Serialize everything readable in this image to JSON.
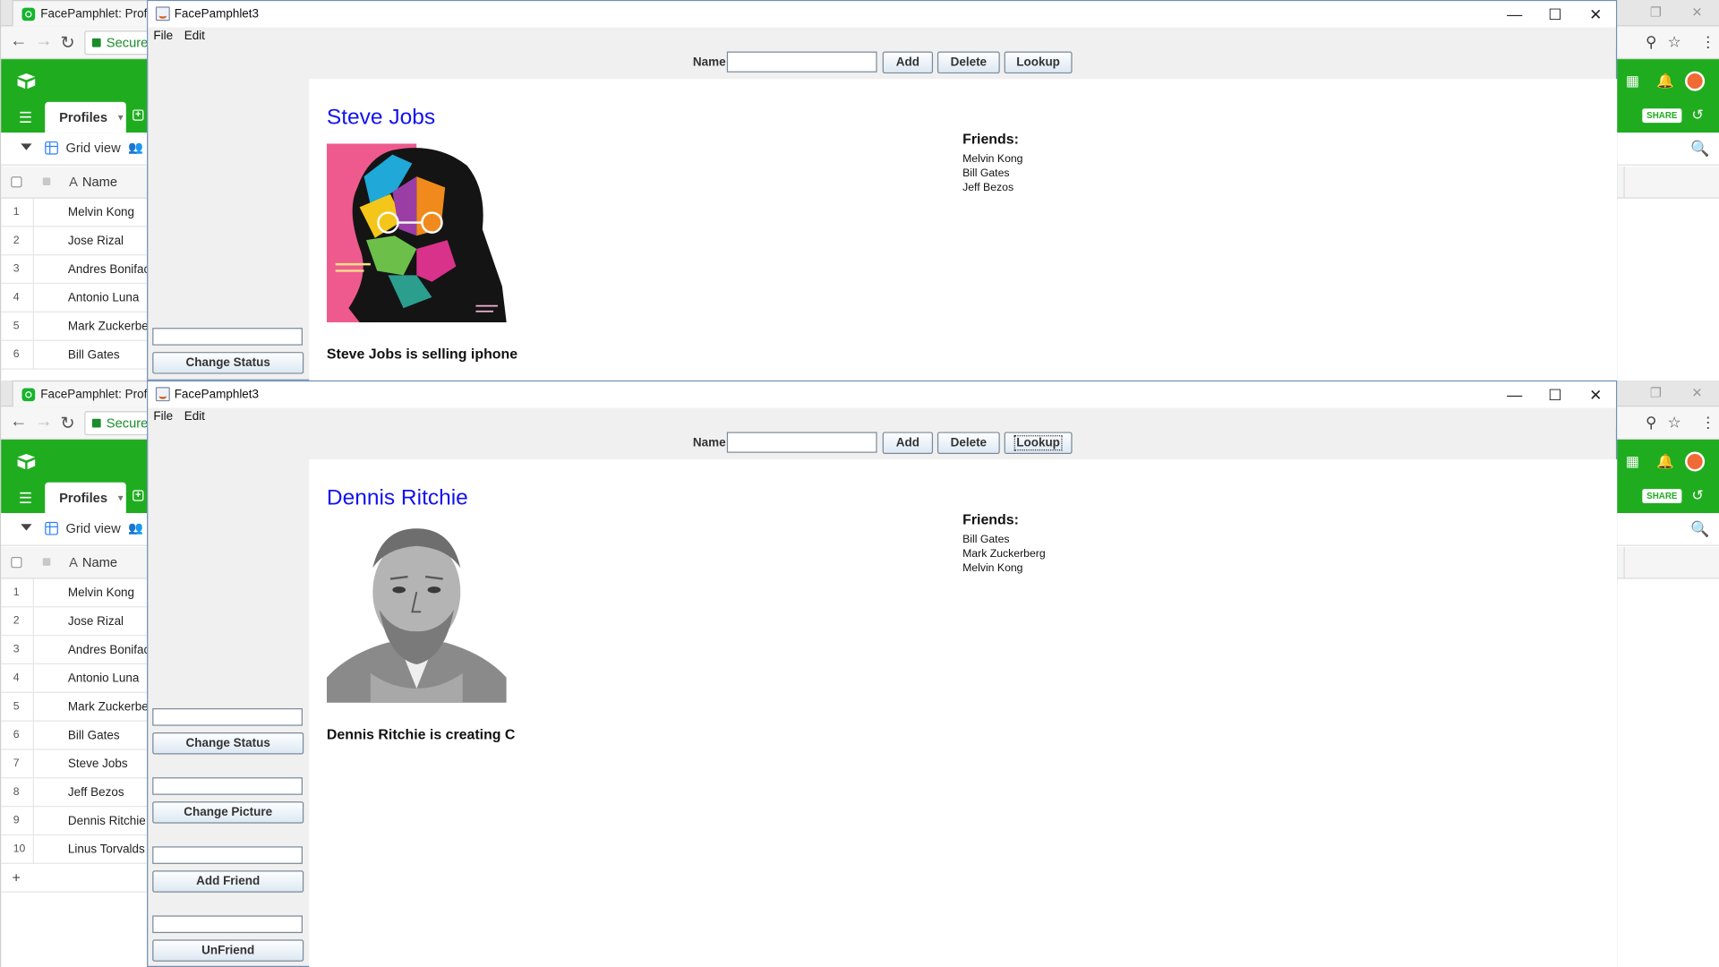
{
  "browser": {
    "tab_title": "FacePamphlet: Profiles",
    "omnibox": "Secure",
    "airtable": {
      "table_tab": "Profiles",
      "view_name": "Grid view",
      "share_label": "SHARE",
      "column_name": "Name",
      "column_type_glyph": "A",
      "rows_top": [
        {
          "num": "1",
          "name": "Melvin Kong"
        },
        {
          "num": "2",
          "name": "Jose Rizal"
        },
        {
          "num": "3",
          "name": "Andres Bonifacio"
        },
        {
          "num": "4",
          "name": "Antonio Luna"
        },
        {
          "num": "5",
          "name": "Mark Zuckerberg"
        },
        {
          "num": "6",
          "name": "Bill Gates"
        }
      ],
      "rows_bottom": [
        {
          "num": "1",
          "name": "Melvin Kong"
        },
        {
          "num": "2",
          "name": "Jose Rizal"
        },
        {
          "num": "3",
          "name": "Andres Bonifacio"
        },
        {
          "num": "4",
          "name": "Antonio Luna"
        },
        {
          "num": "5",
          "name": "Mark Zuckerberg"
        },
        {
          "num": "6",
          "name": "Bill Gates"
        },
        {
          "num": "7",
          "name": "Steve Jobs"
        },
        {
          "num": "8",
          "name": "Jeff Bezos"
        },
        {
          "num": "9",
          "name": "Dennis Ritchie"
        },
        {
          "num": "10",
          "name": "Linus Torvalds"
        }
      ],
      "add_row_glyph": "+"
    }
  },
  "windows": [
    {
      "title": "FacePamphlet3",
      "menus": [
        "File",
        "Edit"
      ],
      "name_label": "Name",
      "name_value": "",
      "buttons": {
        "add": "Add",
        "delete": "Delete",
        "lookup": "Lookup"
      },
      "side": {
        "change_status": "Change Status"
      },
      "profile": {
        "name": "Steve Jobs",
        "status": "Steve Jobs is selling iphone",
        "friends_label": "Friends:",
        "friends": [
          "Melvin Kong",
          "Bill Gates",
          "Jeff Bezos"
        ]
      }
    },
    {
      "title": "FacePamphlet3",
      "menus": [
        "File",
        "Edit"
      ],
      "name_label": "Name",
      "name_value": "",
      "buttons": {
        "add": "Add",
        "delete": "Delete",
        "lookup": "Lookup"
      },
      "side": {
        "change_status": "Change Status",
        "change_picture": "Change Picture",
        "add_friend": "Add Friend",
        "unfriend": "UnFriend"
      },
      "profile": {
        "name": "Dennis Ritchie",
        "status": "Dennis Ritchie is creating C",
        "friends_label": "Friends:",
        "friends": [
          "Bill Gates",
          "Mark Zuckerberg",
          "Melvin Kong"
        ]
      }
    }
  ],
  "colors": {
    "airtable_green": "#1fad1f",
    "profile_name_blue": "#1212f0",
    "swing_panel": "#f0f0f0"
  },
  "icons": [
    "back-arrow-icon",
    "forward-arrow-icon",
    "reload-icon",
    "lock-icon",
    "airtable-logo-icon",
    "hamburger-menu-icon",
    "grid-view-icon",
    "search-icon",
    "bell-icon",
    "apps-grid-icon",
    "history-icon",
    "minimize-icon",
    "maximize-icon",
    "close-icon",
    "java-app-icon"
  ]
}
